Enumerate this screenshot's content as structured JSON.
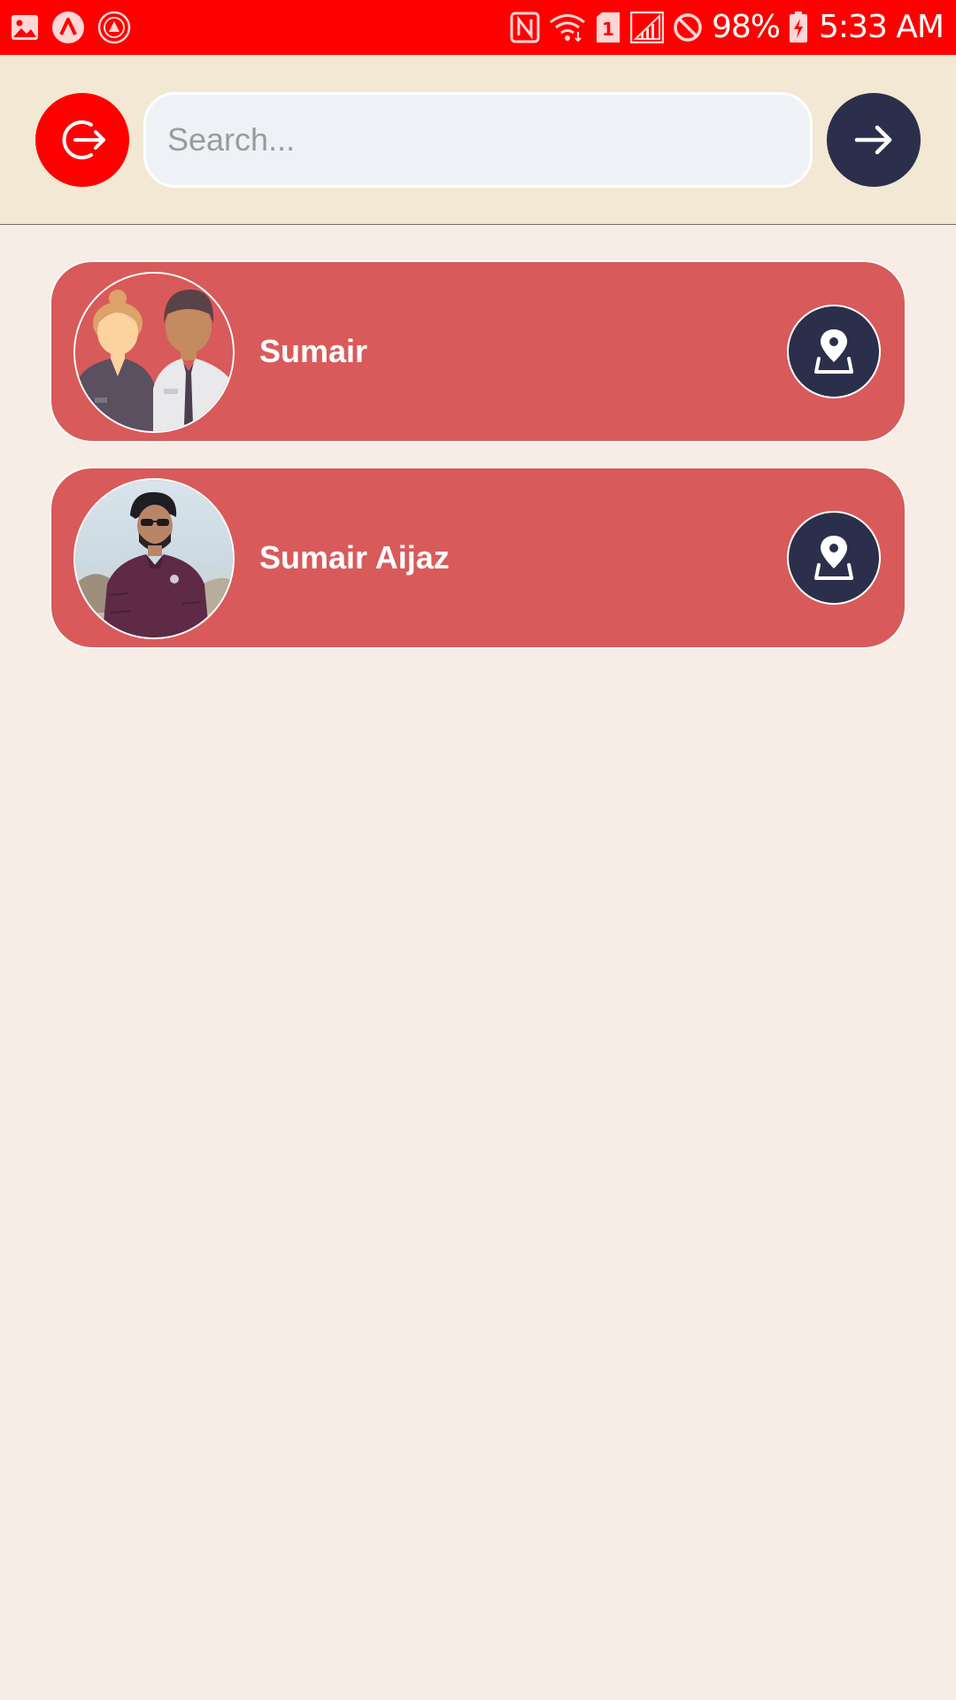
{
  "status_bar": {
    "battery": "98%",
    "time": "5:33 AM",
    "sim_slot": "1",
    "background_color": "#fe0000",
    "left_icons": [
      "image-icon",
      "app-icon",
      "badge-icon"
    ],
    "right_icons": [
      "nfc-icon",
      "wifi-icon",
      "sim-icon",
      "signal-icon",
      "do-not-disturb-icon",
      "battery-charging-icon"
    ]
  },
  "header": {
    "background_color": "#f2e8d3",
    "logout_icon": "logout-icon",
    "search": {
      "placeholder": "Search...",
      "value": ""
    },
    "go_icon": "arrow-right-icon"
  },
  "users": [
    {
      "name": "Sumair",
      "avatar": "group-avatar",
      "action_icon": "location-pin-icon"
    },
    {
      "name": "Sumair Aijaz",
      "avatar": "photo-avatar",
      "action_icon": "location-pin-icon"
    }
  ],
  "colors": {
    "card": "#d95a5a",
    "primary_dark": "#2b2f4b",
    "accent_red": "#fe0000",
    "page_background": "#f7ede4"
  }
}
